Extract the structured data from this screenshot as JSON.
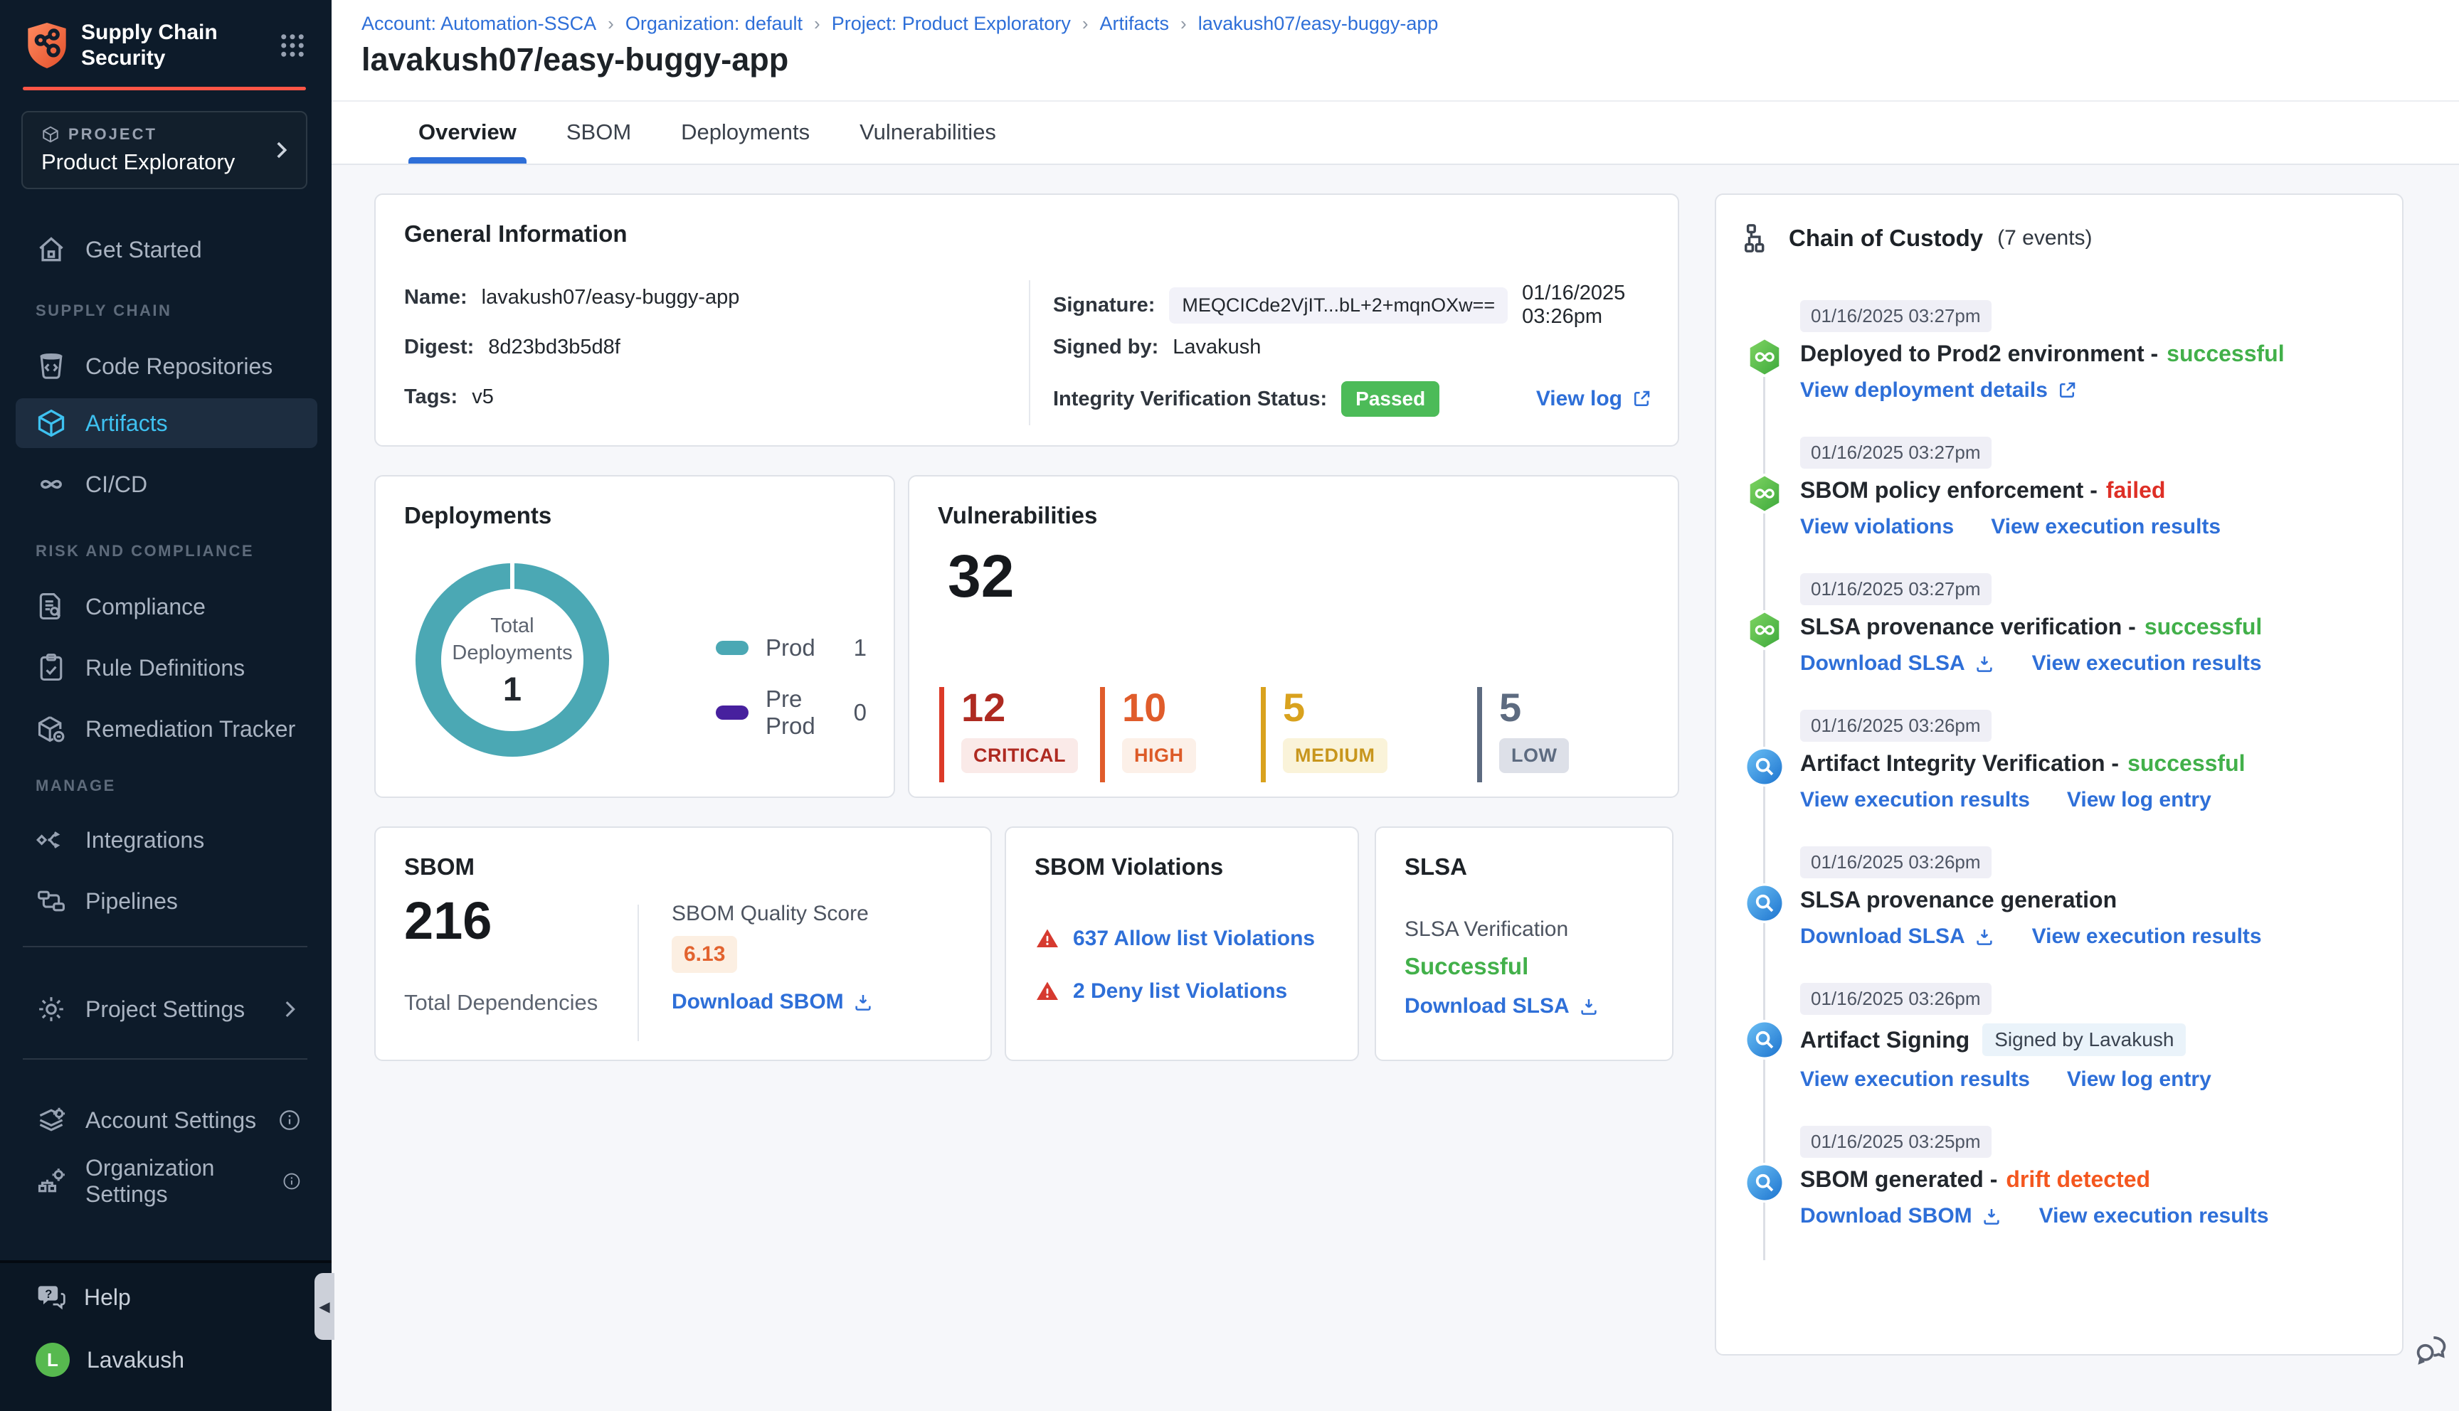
{
  "colors": {
    "accent_orange": "#FF5546",
    "link_blue": "#2E6FD8",
    "active_nav_blue": "#3EC1F0",
    "teal_prod": "#4BA8B4",
    "purple_preprod": "#47209E",
    "green_success": "#42B04A",
    "green_passed_badge": "#4CBB58",
    "red_failed": "#DE2F26",
    "orange_drift": "#F4571F",
    "critical": "#AE2A21",
    "high": "#E05C2B",
    "medium": "#D9A21E",
    "low": "#5D6B80"
  },
  "sidebar": {
    "logo": {
      "line1": "Supply Chain",
      "line2": "Security"
    },
    "project": {
      "eyebrow": "PROJECT",
      "name": "Product Exploratory"
    },
    "nav": {
      "get_started": "Get Started",
      "section_supply_chain": "SUPPLY CHAIN",
      "code_repositories": "Code Repositories",
      "artifacts": "Artifacts",
      "cicd": "CI/CD",
      "section_risk": "RISK AND COMPLIANCE",
      "compliance": "Compliance",
      "rule_definitions": "Rule Definitions",
      "remediation_tracker": "Remediation Tracker",
      "section_manage": "MANAGE",
      "integrations": "Integrations",
      "pipelines": "Pipelines",
      "project_settings": "Project Settings",
      "account_settings": "Account Settings",
      "organization_settings": "Organization Settings"
    },
    "footer": {
      "help": "Help",
      "user": "Lavakush",
      "user_initial": "L"
    }
  },
  "breadcrumb": {
    "separator": "›",
    "items": [
      "Account: Automation-SSCA",
      "Organization: default",
      "Project: Product Exploratory",
      "Artifacts",
      "lavakush07/easy-buggy-app"
    ]
  },
  "header": {
    "title": "lavakush07/easy-buggy-app",
    "tabs": [
      {
        "label": "Overview",
        "active": true
      },
      {
        "label": "SBOM",
        "active": false
      },
      {
        "label": "Deployments",
        "active": false
      },
      {
        "label": "Vulnerabilities",
        "active": false
      }
    ]
  },
  "general": {
    "title": "General Information",
    "name_label": "Name:",
    "name_value": "lavakush07/easy-buggy-app",
    "digest_label": "Digest:",
    "digest_value": "8d23bd3b5d8f",
    "tags_label": "Tags:",
    "tags_value": "v5",
    "signature_label": "Signature:",
    "signature_value": "MEQCICde2VjIT...bL+2+mqnOXw==",
    "signature_time": "01/16/2025 03:26pm",
    "signed_by_label": "Signed by:",
    "signed_by_value": "Lavakush",
    "integrity_label": "Integrity Verification Status:",
    "integrity_badge": "Passed",
    "view_log": "View log"
  },
  "deployments": {
    "title": "Deployments",
    "center_line1": "Total",
    "center_line2": "Deployments",
    "total": "1",
    "legend": [
      {
        "label": "Prod",
        "value": "1"
      },
      {
        "label": "Pre Prod",
        "value": "0"
      }
    ],
    "chart_data": {
      "type": "pie",
      "title": "Total Deployments",
      "categories": [
        "Prod",
        "Pre Prod"
      ],
      "values": [
        1,
        0
      ],
      "total": 1,
      "colors": [
        "#4BA8B4",
        "#47209E"
      ],
      "legend_position": "right"
    }
  },
  "vulnerabilities": {
    "title": "Vulnerabilities",
    "total": "32",
    "items": [
      {
        "value": "12",
        "label": "CRITICAL"
      },
      {
        "value": "10",
        "label": "HIGH"
      },
      {
        "value": "5",
        "label": "MEDIUM"
      },
      {
        "value": "5",
        "label": "LOW"
      }
    ]
  },
  "sbom": {
    "title": "SBOM",
    "total": "216",
    "total_label": "Total Dependencies",
    "quality_label": "SBOM Quality Score",
    "score": "6.13",
    "download": "Download SBOM"
  },
  "violations": {
    "title": "SBOM Violations",
    "allow": "637 Allow list Violations",
    "deny": "2 Deny list Violations"
  },
  "slsa": {
    "title": "SLSA",
    "verification_label": "SLSA Verification",
    "verification_status": "Successful",
    "download": "Download SLSA"
  },
  "coc": {
    "title": "Chain of Custody",
    "count": "(7 events)",
    "events": [
      {
        "time": "01/16/2025 03:27pm",
        "title": "Deployed to Prod2 environment -",
        "status": "successful",
        "links": [
          {
            "label": "View deployment details"
          }
        ]
      },
      {
        "time": "01/16/2025 03:27pm",
        "title": "SBOM policy enforcement -",
        "status": "failed",
        "links": [
          {
            "label": "View violations"
          },
          {
            "label": "View execution results"
          }
        ]
      },
      {
        "time": "01/16/2025 03:27pm",
        "title": "SLSA provenance verification -",
        "status": "successful",
        "links": [
          {
            "label": "Download SLSA"
          },
          {
            "label": "View execution results"
          }
        ]
      },
      {
        "time": "01/16/2025 03:26pm",
        "title": "Artifact Integrity Verification -",
        "status": "successful",
        "links": [
          {
            "label": "View execution results"
          },
          {
            "label": "View log entry"
          }
        ]
      },
      {
        "time": "01/16/2025 03:26pm",
        "title": "SLSA provenance generation",
        "links": [
          {
            "label": "Download SLSA"
          },
          {
            "label": "View execution results"
          }
        ]
      },
      {
        "time": "01/16/2025 03:26pm",
        "title": "Artifact Signing",
        "badge": "Signed by Lavakush",
        "links": [
          {
            "label": "View execution results"
          },
          {
            "label": "View log entry"
          }
        ]
      },
      {
        "time": "01/16/2025 03:25pm",
        "title": "SBOM generated -",
        "status": "drift detected",
        "links": [
          {
            "label": "Download SBOM"
          },
          {
            "label": "View execution results"
          }
        ]
      }
    ]
  }
}
